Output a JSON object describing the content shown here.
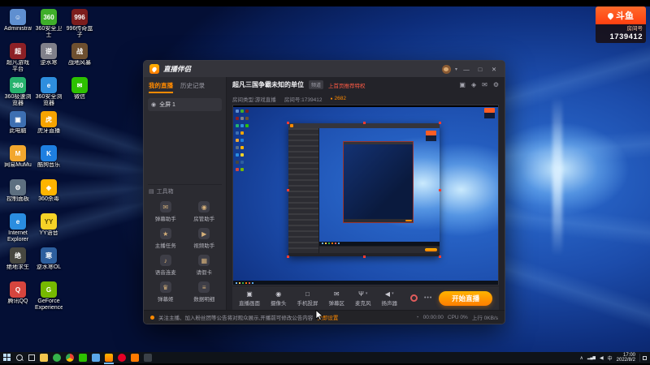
{
  "overlay": {
    "brand": "斗鱼",
    "room_label": "房间号",
    "room_number": "1739412"
  },
  "desktop": {
    "icons": [
      {
        "name": "user-folder",
        "label": "Administrator",
        "glyph": "☺",
        "color": "#5f8fd0"
      },
      {
        "name": "game-platform",
        "label": "超凡游戏平台",
        "glyph": "超",
        "color": "#8d2026"
      },
      {
        "name": "browser-360-speed",
        "label": "360极速浏览器",
        "glyph": "360",
        "color": "#27b26e"
      },
      {
        "name": "this-pc",
        "label": "此电脑",
        "glyph": "▣",
        "color": "#3d6fb2"
      },
      {
        "name": "netease-mumu",
        "label": "网易MuMu",
        "glyph": "M",
        "color": "#f2a72e"
      },
      {
        "name": "control-panel",
        "label": "控制面板",
        "glyph": "⚙",
        "color": "#5d6f80"
      },
      {
        "name": "internet-explorer",
        "label": "Internet Explorer",
        "glyph": "e",
        "color": "#2a8de0"
      },
      {
        "name": "pubg",
        "label": "绝地求生",
        "glyph": "绝",
        "color": "#474740"
      },
      {
        "name": "qq",
        "label": "腾讯QQ",
        "glyph": "Q",
        "color": "#d6453e"
      },
      {
        "name": "360-safe",
        "label": "360安全卫士",
        "glyph": "360",
        "color": "#3fae2a"
      },
      {
        "name": "nishuihan",
        "label": "逆水寒",
        "glyph": "逆",
        "color": "#80808a"
      },
      {
        "name": "browser-360",
        "label": "360安全浏览器",
        "glyph": "e",
        "color": "#2e8ede"
      },
      {
        "name": "huya",
        "label": "虎牙直播",
        "glyph": "虎",
        "color": "#f7a400"
      },
      {
        "name": "kugou",
        "label": "酷狗音乐",
        "glyph": "K",
        "color": "#1e7fe0"
      },
      {
        "name": "360-antivirus",
        "label": "360杀毒",
        "glyph": "◈",
        "color": "#ffb400"
      },
      {
        "name": "yy-voice",
        "label": "YY语音",
        "glyph": "YY",
        "color": "#f5d327",
        "fg": "#5a4a00"
      },
      {
        "name": "nishuihan-ol",
        "label": "逆水寒OL",
        "glyph": "寒",
        "color": "#2d5f9e"
      },
      {
        "name": "geforce-experience",
        "label": "GeForce Experience",
        "glyph": "G",
        "color": "#76b900"
      },
      {
        "name": "996-box",
        "label": "996传奇盒子",
        "glyph": "996",
        "color": "#7c1d1d"
      },
      {
        "name": "zhandi",
        "label": "战地风暴",
        "glyph": "战",
        "color": "#6e4f2f"
      },
      {
        "name": "wechat",
        "label": "微信",
        "glyph": "✉",
        "color": "#2dc100"
      }
    ]
  },
  "app": {
    "logo_text": "直播伴侣",
    "controls": {
      "avatar_caret": "▾",
      "minimize": "—",
      "maximize": "□",
      "close": "✕"
    },
    "tabs": [
      {
        "label": "我的直播",
        "state": "active"
      },
      {
        "label": "历史记录",
        "state": ""
      }
    ],
    "source": {
      "eye": "◉",
      "label": "全屏 1"
    },
    "toolbox_icon": "▤",
    "toolbox_label": "工具箱",
    "tools": [
      {
        "label": "弹幕助手",
        "glyph": "✉"
      },
      {
        "label": "房管助手",
        "glyph": "◉"
      },
      {
        "label": "主播任务",
        "glyph": "★"
      },
      {
        "label": "视频助手",
        "glyph": "▶"
      },
      {
        "label": "语音连麦",
        "glyph": "♪"
      },
      {
        "label": "请假卡",
        "glyph": "▦"
      },
      {
        "label": "弹幕姬",
        "glyph": "♛"
      },
      {
        "label": "数据明细",
        "glyph": "≡"
      }
    ],
    "header": {
      "title": "超凡三国争霸未知的单位",
      "channel_chip": "频道",
      "promo": "上首页推荐特权",
      "room_type": "房间类型:游戏直播",
      "room_id_label": "房间号:",
      "room_id": "1739412",
      "hot_dot": "●",
      "hot": "2682"
    },
    "header_icons": [
      {
        "name": "mini-window-icon",
        "glyph": "▣"
      },
      {
        "name": "lock-icon",
        "glyph": "◈"
      },
      {
        "name": "message-icon",
        "glyph": "✉"
      },
      {
        "name": "settings-icon",
        "glyph": "⚙"
      }
    ],
    "toolbar": {
      "buttons": [
        {
          "label": "直播画面",
          "glyph": "▣"
        },
        {
          "label": "摄像头",
          "glyph": "◉"
        },
        {
          "label": "手机投屏",
          "glyph": "□"
        },
        {
          "label": "弹幕区",
          "glyph": "✉"
        },
        {
          "label": "麦克风",
          "glyph": "Ψ",
          "caret": "▾"
        },
        {
          "label": "扬声器",
          "glyph": "◀",
          "caret": "▾"
        }
      ],
      "more": "•••",
      "start_button": "开始直播"
    },
    "status": {
      "announcement": "关注主播、加入粉丝团等公告将对观众展示,开播前可修改公告内容",
      "announcement_link": "立即设置",
      "duration_icon": "◔",
      "duration": "00:00:00",
      "cpu": "CPU 0%",
      "net": "上行 0KB/s"
    }
  },
  "taskbar": {
    "apps": [
      {
        "name": "file-explorer",
        "bg": "#f3c64e",
        "shape": "",
        "state": ""
      },
      {
        "name": "browser-360",
        "bg": "#35b34a",
        "shape": "round",
        "state": ""
      },
      {
        "name": "chrome",
        "bg": "conic-gradient(#ea4335 0 120deg,#fbbc05 120deg 240deg,#34a853 240deg 360deg)",
        "shape": "round",
        "state": ""
      },
      {
        "name": "wechat",
        "bg": "#2dc100",
        "shape": "",
        "state": ""
      },
      {
        "name": "qq",
        "bg": "#5aa7e8",
        "shape": "",
        "state": ""
      },
      {
        "name": "live-companion",
        "bg": "linear-gradient(180deg,#ffb300,#ff7a00)",
        "shape": "",
        "state": "active"
      },
      {
        "name": "netease-music",
        "bg": "#e60026",
        "shape": "round",
        "state": ""
      },
      {
        "name": "douyu",
        "bg": "#ff7a00",
        "shape": "",
        "state": ""
      },
      {
        "name": "obs",
        "bg": "#3a4047",
        "shape": "",
        "state": ""
      }
    ],
    "tray": {
      "caret": "∧",
      "net": "▂▄▆",
      "vol": "◀",
      "ime": "中",
      "time": "17:00",
      "date": "2022/8/2"
    }
  }
}
